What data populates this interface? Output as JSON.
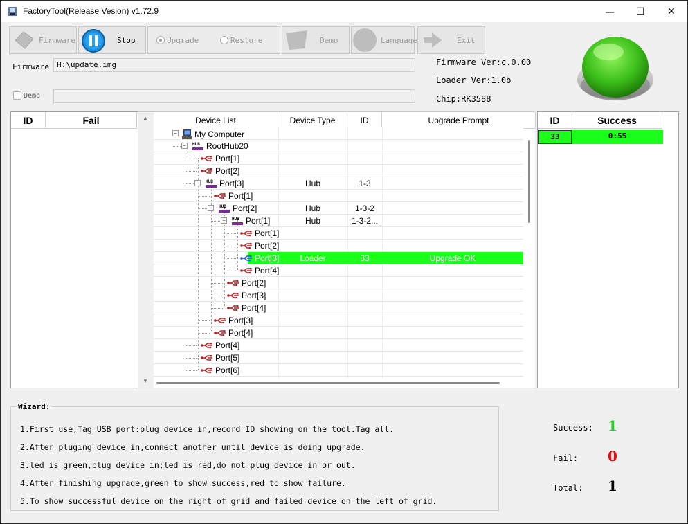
{
  "window": {
    "title": "FactoryTool(Release Vesion) v1.72.9",
    "minimize": "—",
    "maximize": "☐",
    "close": "✕"
  },
  "toolbar": {
    "firmware": "Firmware",
    "stop": "Stop",
    "upgrade": "Upgrade",
    "restore": "Restore",
    "demo": "Demo",
    "language": "Language",
    "exit": "Exit"
  },
  "firmware_row": {
    "label": "Firmware",
    "path": "H:\\update.img"
  },
  "demo_row": {
    "label": "Demo",
    "value": ""
  },
  "info": {
    "firmware_ver": "Firmware Ver:c.0.00",
    "loader_ver": "Loader Ver:1.0b",
    "chip": "Chip:RK3588"
  },
  "fail_grid": {
    "col_id": "ID",
    "col_fail": "Fail"
  },
  "success_grid": {
    "col_id": "ID",
    "col_success": "Success",
    "rows": [
      {
        "id": "33",
        "time": "0:55"
      }
    ]
  },
  "device_list": {
    "headers": {
      "device_list": "Device List",
      "device_type": "Device Type",
      "id": "ID",
      "upgrade_prompt": "Upgrade Prompt"
    },
    "rows": [
      {
        "label": "My Computer",
        "type": "",
        "id": "",
        "prompt": "",
        "icon": "computer-icon"
      },
      {
        "label": "RootHub20",
        "type": "",
        "id": "",
        "prompt": "",
        "icon": "hub-icon"
      },
      {
        "label": "Port[1]",
        "type": "",
        "id": "",
        "prompt": "",
        "icon": "usb-icon"
      },
      {
        "label": "Port[2]",
        "type": "",
        "id": "",
        "prompt": "",
        "icon": "usb-icon"
      },
      {
        "label": "Port[3]",
        "type": "Hub",
        "id": "1-3",
        "prompt": "",
        "icon": "hub-icon"
      },
      {
        "label": "Port[1]",
        "type": "",
        "id": "",
        "prompt": "",
        "icon": "usb-icon"
      },
      {
        "label": "Port[2]",
        "type": "Hub",
        "id": "1-3-2",
        "prompt": "",
        "icon": "hub-icon"
      },
      {
        "label": "Port[1]",
        "type": "Hub",
        "id": "1-3-2...",
        "prompt": "",
        "icon": "hub-icon"
      },
      {
        "label": "Port[1]",
        "type": "",
        "id": "",
        "prompt": "",
        "icon": "usb-icon"
      },
      {
        "label": "Port[2]",
        "type": "",
        "id": "",
        "prompt": "",
        "icon": "usb-icon"
      },
      {
        "label": "Port[3]",
        "type": "Loader",
        "id": "33",
        "prompt": "Upgrade OK",
        "icon": "usb-active-icon"
      },
      {
        "label": "Port[4]",
        "type": "",
        "id": "",
        "prompt": "",
        "icon": "usb-icon"
      },
      {
        "label": "Port[2]",
        "type": "",
        "id": "",
        "prompt": "",
        "icon": "usb-icon"
      },
      {
        "label": "Port[3]",
        "type": "",
        "id": "",
        "prompt": "",
        "icon": "usb-icon"
      },
      {
        "label": "Port[4]",
        "type": "",
        "id": "",
        "prompt": "",
        "icon": "usb-icon"
      },
      {
        "label": "Port[3]",
        "type": "",
        "id": "",
        "prompt": "",
        "icon": "usb-icon"
      },
      {
        "label": "Port[4]",
        "type": "",
        "id": "",
        "prompt": "",
        "icon": "usb-icon"
      },
      {
        "label": "Port[4]",
        "type": "",
        "id": "",
        "prompt": "",
        "icon": "usb-icon"
      },
      {
        "label": "Port[5]",
        "type": "",
        "id": "",
        "prompt": "",
        "icon": "usb-icon"
      },
      {
        "label": "Port[6]",
        "type": "",
        "id": "",
        "prompt": "",
        "icon": "usb-icon"
      }
    ]
  },
  "wizard": {
    "title": "Wizard:",
    "lines": [
      "1.First use,Tag USB port:plug device in,record ID showing on the tool.Tag all.",
      "2.After pluging device in,connect another until device is doing upgrade.",
      "3.led is green,plug device in;led is red,do not plug device in or out.",
      "4.After finishing upgrade,green to show success,red to show failure.",
      "5.To show successful device on the right of grid and failed device on the left of grid."
    ]
  },
  "stats": {
    "success_label": "Success:",
    "success_value": "1",
    "fail_label": "Fail:",
    "fail_value": "0",
    "total_label": "Total:",
    "total_value": "1"
  },
  "colors": {
    "highlight": "#1aff1a",
    "success": "#22cc22",
    "fail": "#ff0000"
  }
}
